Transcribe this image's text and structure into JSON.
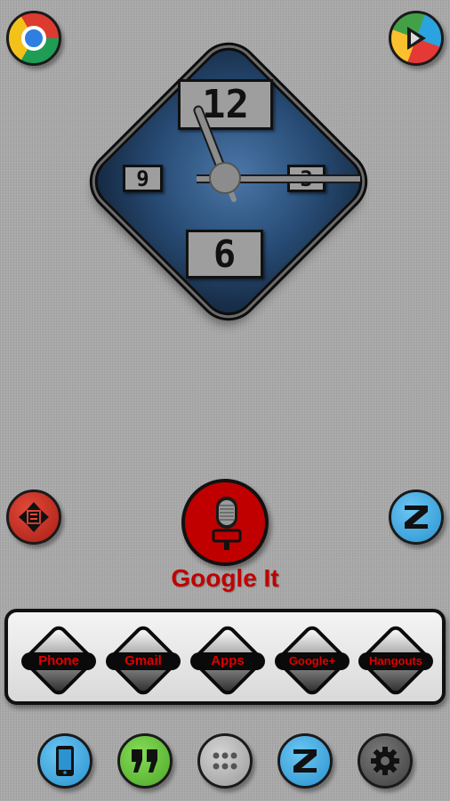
{
  "top_icons": {
    "left": {
      "name": "Chrome"
    },
    "right": {
      "name": "Play Store"
    }
  },
  "clock": {
    "numerals": {
      "top": "12",
      "left": "9",
      "right": "3",
      "bottom": "6"
    },
    "colors": {
      "face": "#2f5a8c",
      "numeral_fill": "#9e9e9e",
      "hand": "#8c8c8c"
    }
  },
  "side_icons": {
    "left": {
      "name": "Move"
    },
    "right": {
      "name": "Zooper"
    }
  },
  "google": {
    "label": "Google It"
  },
  "dock": {
    "buttons": [
      {
        "label": "Phone"
      },
      {
        "label": "Gmail"
      },
      {
        "label": "Apps"
      },
      {
        "label": "Google+"
      },
      {
        "label": "Hangouts"
      }
    ]
  },
  "bottom_bar": {
    "icons": [
      "phone-icon",
      "hangouts-quote-icon",
      "app-drawer-icon",
      "zooper-icon",
      "settings-gear-icon"
    ]
  },
  "colors": {
    "accent_red": "#c00000",
    "label_red": "#e00000",
    "blue": "#39a7e3",
    "green": "#68c83a"
  }
}
